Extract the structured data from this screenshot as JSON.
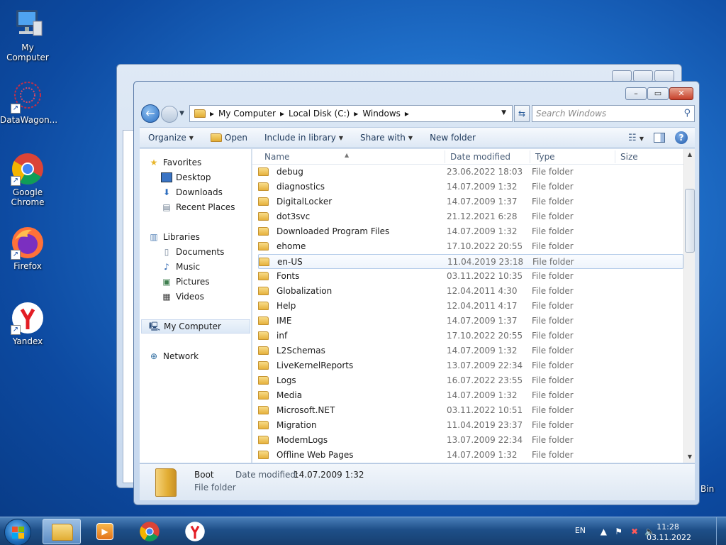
{
  "desktop": {
    "icons": [
      {
        "label": "My Computer",
        "icon": "computer-icon"
      },
      {
        "label": "DataWagon...",
        "icon": "datawagon-icon"
      },
      {
        "label": "Google Chrome",
        "icon": "chrome-icon"
      },
      {
        "label": "Firefox",
        "icon": "firefox-icon"
      },
      {
        "label": "Yandex",
        "icon": "yandex-icon"
      }
    ],
    "bin_label": "Bin"
  },
  "window": {
    "address": {
      "segments": [
        "My Computer",
        "Local Disk (C:)",
        "Windows"
      ],
      "search_placeholder": "Search Windows"
    },
    "toolbar": {
      "organize": "Organize",
      "open": "Open",
      "include_in_library": "Include in library",
      "share_with": "Share with",
      "new_folder": "New folder"
    },
    "nav": {
      "favorites": "Favorites",
      "desktop": "Desktop",
      "downloads": "Downloads",
      "recent_places": "Recent Places",
      "libraries": "Libraries",
      "documents": "Documents",
      "music": "Music",
      "pictures": "Pictures",
      "videos": "Videos",
      "my_computer": "My Computer",
      "network": "Network"
    },
    "columns": {
      "name": "Name",
      "date": "Date modified",
      "type": "Type",
      "size": "Size"
    },
    "files": [
      {
        "name": "debug",
        "date": "23.06.2022 18:03",
        "type": "File folder"
      },
      {
        "name": "diagnostics",
        "date": "14.07.2009 1:32",
        "type": "File folder"
      },
      {
        "name": "DigitalLocker",
        "date": "14.07.2009 1:37",
        "type": "File folder"
      },
      {
        "name": "dot3svc",
        "date": "21.12.2021 6:28",
        "type": "File folder"
      },
      {
        "name": "Downloaded Program Files",
        "date": "14.07.2009 1:32",
        "type": "File folder"
      },
      {
        "name": "ehome",
        "date": "17.10.2022 20:55",
        "type": "File folder"
      },
      {
        "name": "en-US",
        "date": "11.04.2019 23:18",
        "type": "File folder"
      },
      {
        "name": "Fonts",
        "date": "03.11.2022 10:35",
        "type": "File folder"
      },
      {
        "name": "Globalization",
        "date": "12.04.2011 4:30",
        "type": "File folder"
      },
      {
        "name": "Help",
        "date": "12.04.2011 4:17",
        "type": "File folder"
      },
      {
        "name": "IME",
        "date": "14.07.2009 1:37",
        "type": "File folder"
      },
      {
        "name": "inf",
        "date": "17.10.2022 20:55",
        "type": "File folder"
      },
      {
        "name": "L2Schemas",
        "date": "14.07.2009 1:32",
        "type": "File folder"
      },
      {
        "name": "LiveKernelReports",
        "date": "13.07.2009 22:34",
        "type": "File folder"
      },
      {
        "name": "Logs",
        "date": "16.07.2022 23:55",
        "type": "File folder"
      },
      {
        "name": "Media",
        "date": "14.07.2009 1:32",
        "type": "File folder"
      },
      {
        "name": "Microsoft.NET",
        "date": "03.11.2022 10:51",
        "type": "File folder"
      },
      {
        "name": "Migration",
        "date": "11.04.2019 23:37",
        "type": "File folder"
      },
      {
        "name": "ModemLogs",
        "date": "13.07.2009 22:34",
        "type": "File folder"
      },
      {
        "name": "Offline Web Pages",
        "date": "14.07.2009 1:32",
        "type": "File folder"
      }
    ],
    "details": {
      "name": "Boot",
      "date_label": "Date modified:",
      "date_value": "14.07.2009 1:32",
      "type": "File folder"
    }
  },
  "taskbar": {
    "language": "EN",
    "time": "11:28",
    "date": "03.11.2022"
  },
  "colors": {
    "accent": "#1f6fc9",
    "taskbar": "#1e4f88",
    "folder": "#e6b13c"
  }
}
